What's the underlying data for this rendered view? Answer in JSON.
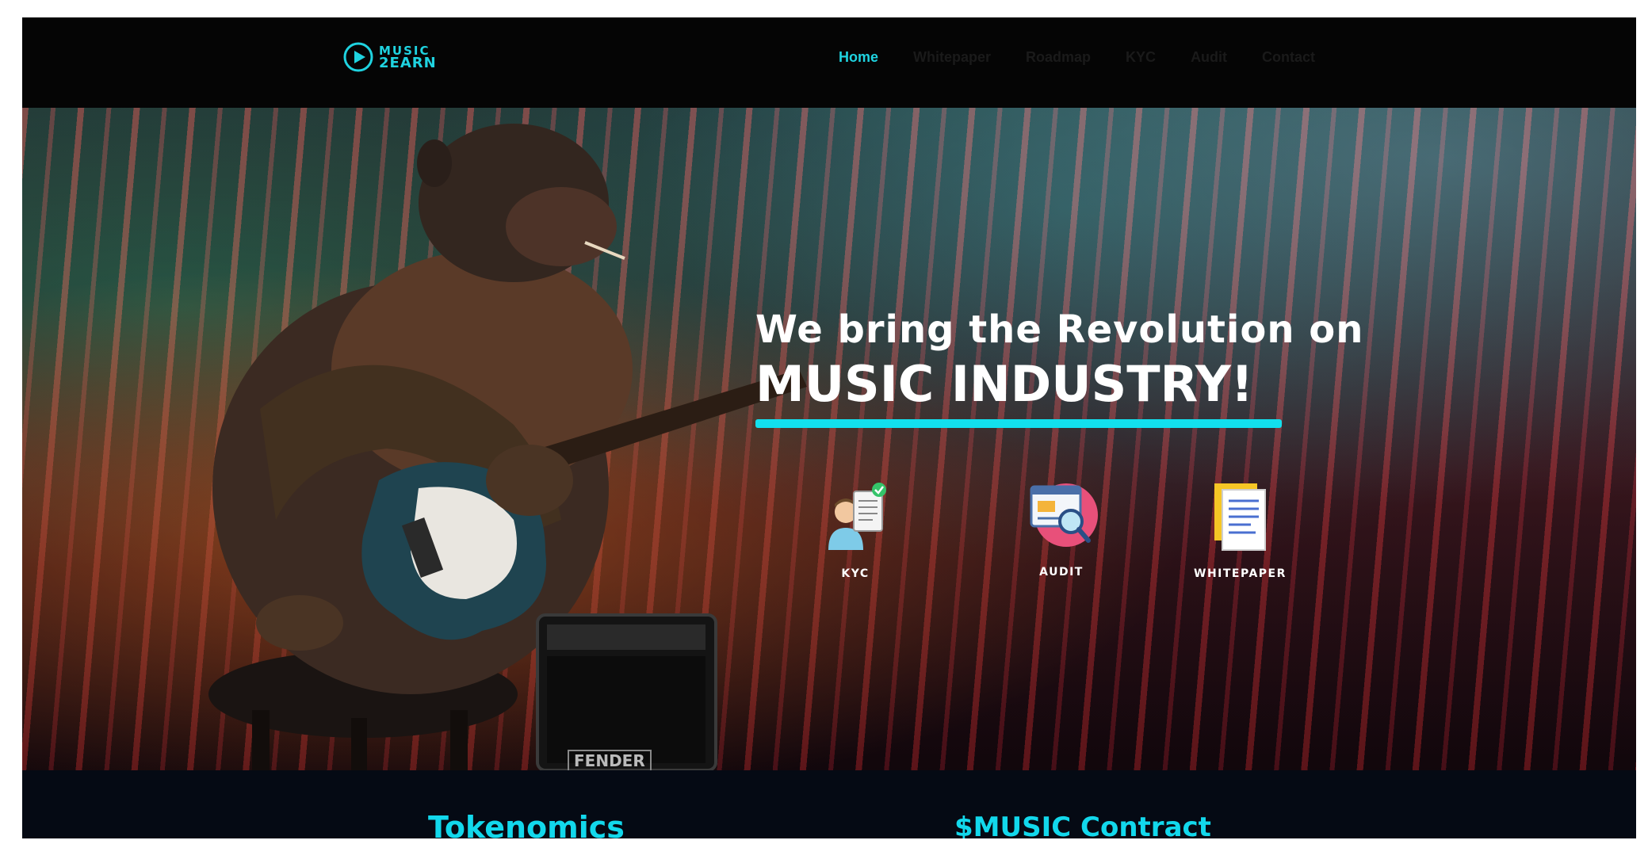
{
  "brand": {
    "line1": "MUSIC",
    "line2": "2EARN",
    "accent": "#1fd3e0"
  },
  "nav": {
    "items": [
      {
        "label": "Home",
        "active": true
      },
      {
        "label": "Whitepaper",
        "active": false
      },
      {
        "label": "Roadmap",
        "active": false
      },
      {
        "label": "KYC",
        "active": false
      },
      {
        "label": "Audit",
        "active": false
      },
      {
        "label": "Contact",
        "active": false
      }
    ]
  },
  "hero": {
    "line1": "We bring the Revolution on",
    "line2": "MUSIC INDUSTRY!",
    "amp_brand": "FENDER",
    "features": [
      {
        "label": "KYC",
        "icon": "kyc-document-icon"
      },
      {
        "label": "AUDIT",
        "icon": "audit-magnifier-icon"
      },
      {
        "label": "WHITEPAPER",
        "icon": "whitepaper-pages-icon"
      }
    ]
  },
  "sections": {
    "tokenomics": "Tokenomics",
    "contract": "$MUSIC Contract"
  }
}
